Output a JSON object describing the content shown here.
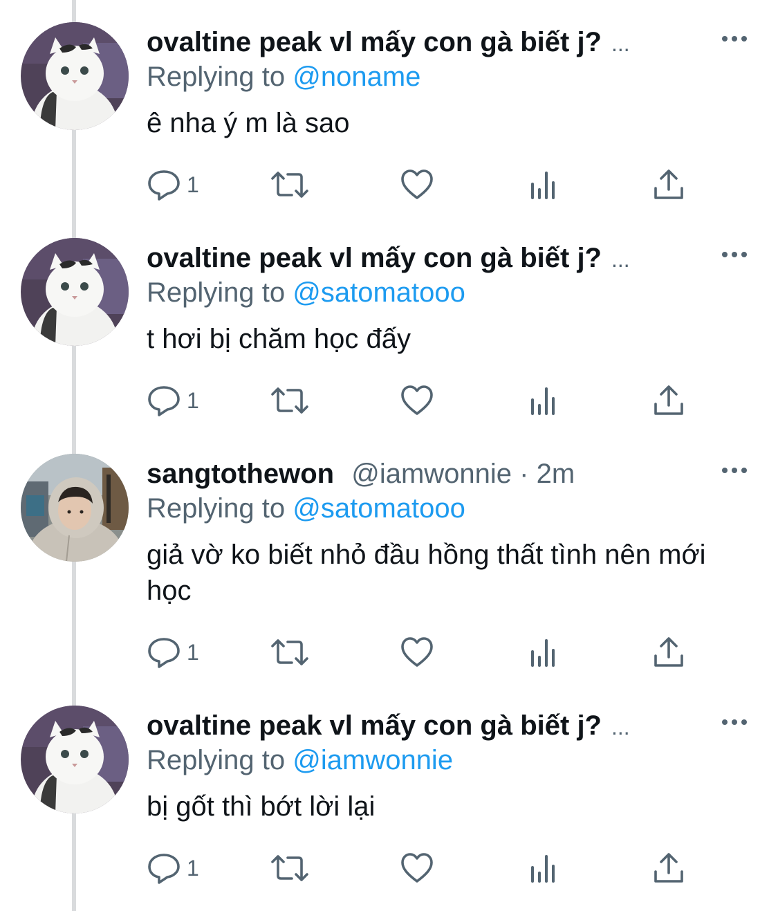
{
  "tweets": [
    {
      "name": "ovaltine peak vl mấy con gà biết j?",
      "name_truncation": "...",
      "handle": "",
      "separator": "",
      "time": "",
      "reply_prefix": "Replying to",
      "reply_to": "@noname",
      "text": "ê nha ý m là sao",
      "reply_count": "1",
      "avatar": "cat-avatar"
    },
    {
      "name": "ovaltine peak vl mấy con gà biết j?",
      "name_truncation": "...",
      "handle": "",
      "separator": "",
      "time": "",
      "reply_prefix": "Replying to",
      "reply_to": "@satomatooo",
      "text": "t hơi bị chăm học đấy",
      "reply_count": "1",
      "avatar": "cat-avatar"
    },
    {
      "name": "sangtothewon",
      "name_truncation": "",
      "handle": "@iamwonnie",
      "separator": "·",
      "time": "2m",
      "reply_prefix": "Replying to",
      "reply_to": "@satomatooo",
      "text": "giả vờ ko biết nhỏ đầu hồng thất tình nên mới học",
      "reply_count": "1",
      "avatar": "person-hoodie-avatar"
    },
    {
      "name": "ovaltine peak vl mấy con gà biết j?",
      "name_truncation": "...",
      "handle": "",
      "separator": "",
      "time": "",
      "reply_prefix": "Replying to",
      "reply_to": "@iamwonnie",
      "text": "bị gốt thì bớt lời lại",
      "reply_count": "1",
      "avatar": "cat-avatar"
    }
  ],
  "icons": {
    "more": "more-icon",
    "reply": "reply-icon",
    "retweet": "retweet-icon",
    "like": "heart-icon",
    "views": "views-icon",
    "share": "share-icon"
  },
  "colors": {
    "link": "#1d9bf0",
    "secondary_text": "#536471",
    "primary_text": "#0f1419",
    "thread_line": "#d9dbdd"
  }
}
